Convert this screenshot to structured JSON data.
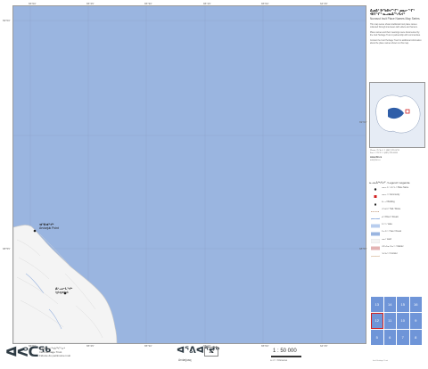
{
  "map": {
    "top_ticks": [
      "66°00'",
      "65°45'",
      "65°30'",
      "65°15'",
      "65°00'",
      "64°45'"
    ],
    "bottom_ticks": [
      "66°00'",
      "65°45'",
      "65°30'",
      "65°15'",
      "65°00'",
      "64°45'"
    ],
    "left_ticks": [
      "69°00'",
      "68°55'"
    ],
    "right_ticks": [
      "69°00'",
      "68°55'"
    ],
    "places": [
      {
        "name": "ᐊᕐᕕᐊᕐᔪᒃ",
        "sub": "Arviarjuk Point"
      },
      {
        "name": "ᐃᒡᓗᓕᒐᕐᔪᒃ",
        "sub": "Iglugarjuk"
      }
    ],
    "colors": {
      "water": "#9ab5e0",
      "land": "#f4f4f4",
      "grid": "#8fa6cf",
      "active": "#d21e1e",
      "tile": "#6f95d8"
    }
  },
  "side": {
    "title": "ᐃᓄᐃᑦ ᐅᖃᐅᓯᖏᑦ ᓄᓇᓕᖏᑦ ᐊᑎᖏᑦ ᓇᓗᓇᐃᖅᓯᒪᔪᑦ",
    "subtitle": "Nunavut Inuit Place Names Map Series",
    "paragraphs": [
      "This map series shows traditional Inuit place names collected through interviews with elders and hunters.",
      "Place names and their meanings were documented by the Inuit Heritage Trust in partnership with communities.",
      "Contact the Inuit Heritage Trust for additional information about the place names shown on this map."
    ],
    "link": "www.ihti.ca",
    "contact": [
      "Phone / ᐅᖃᓘᑦ: 1 (867) 979-0731",
      "Fax / ᓱᑦᑎᑦᑐᑦ: 1 (867) 979-0269",
      "info@ihti.ca"
    ],
    "legend_title": "ᓇᓗᓇᐃᖅᓯᒪᔪᑦ / Legend / Légende",
    "legend": [
      {
        "label": "ᓄᓇᓕᐅᑉ ᐊᑎᖓ / Place Name",
        "sym": "dot"
      },
      {
        "label": "ᓄᓇᓕᒃ / Community",
        "sym": "square"
      },
      {
        "label": "ᐃᒡᓗ / Building",
        "sym": "small"
      },
      {
        "label": "ᐊᖅᑯᑎ / Trail / Route",
        "sym": "dash"
      },
      {
        "label": "ᑯᒃ / River / Stream",
        "sym": "blue-line"
      },
      {
        "label": "ᑕᓯᖅ / Lake",
        "sym": "lake"
      },
      {
        "label": "ᑕᕆᐅᖅ / Sea / Ocean",
        "sym": "sea"
      },
      {
        "label": "ᓄᓇ / Land",
        "sym": "land"
      },
      {
        "label": "ᐊᐅᔭᐅᓂᐊᕐᓂᖅ / Glacier",
        "sym": "ice"
      },
      {
        "label": "ᖃᖅᑲᖅ / Contour",
        "sym": "contour"
      }
    ],
    "index": [
      "13",
      "14",
      "15",
      "16",
      "12",
      "11",
      "10",
      "9",
      "5",
      "6",
      "7",
      "8"
    ],
    "active_index": "12"
  },
  "footer": {
    "logo_mark": "ᐊᕙᑕᖅ",
    "logo_lines": [
      "ᐃᓄᐃᑦ ᐃᓕᖅᑯᓯᖏᓐᓂᒃ",
      "Inuit Heritage Trust",
      "Fiducie du patrimoine inuit"
    ],
    "map_title": "ᐊᕐᕕᐊᕐᔪᒃ",
    "map_title_sub": "Arviarjuaq",
    "map_number": "12",
    "scale": "1 : 50 000",
    "scale_sub": "ᑭᓛᒥᑕ / Kilometres",
    "credits": "Inuit Heritage Trust"
  }
}
